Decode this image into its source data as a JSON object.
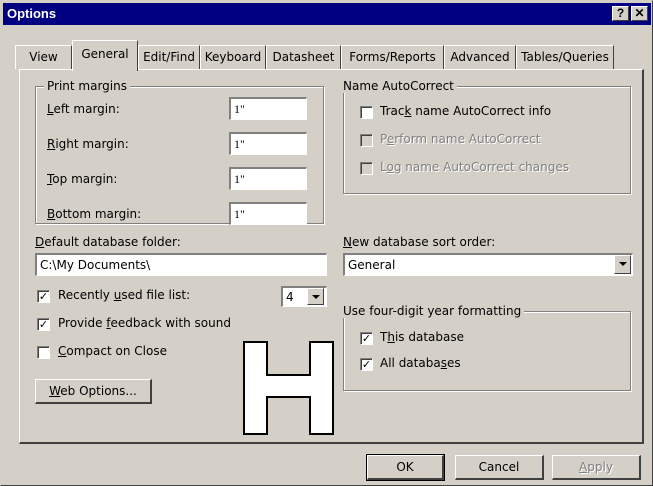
{
  "window": {
    "title": "Options",
    "help_button": "?",
    "close_button": "✕"
  },
  "tabs": [
    {
      "label": "View"
    },
    {
      "label": "General"
    },
    {
      "label": "Edit/Find"
    },
    {
      "label": "Keyboard"
    },
    {
      "label": "Datasheet"
    },
    {
      "label": "Forms/Reports"
    },
    {
      "label": "Advanced"
    },
    {
      "label": "Tables/Queries"
    }
  ],
  "print_margins": {
    "legend": "Print margins",
    "left_label_u": "L",
    "left_label_rest": "eft margin:",
    "left_value": "1\"",
    "right_label_u": "R",
    "right_label_rest": "ight margin:",
    "right_value": "1\"",
    "top_label_u": "T",
    "top_label_rest": "op margin:",
    "top_value": "1\"",
    "bottom_label_u": "B",
    "bottom_label_rest": "ottom margin:",
    "bottom_value": "1\""
  },
  "name_autocorrect": {
    "legend": "Name AutoCorrect",
    "track_pre": "Trac",
    "track_u": "k",
    "track_post": " name AutoCorrect info",
    "perform_pre": "P",
    "perform_u": "e",
    "perform_post": "rform name AutoCorrect",
    "log_pre": "L",
    "log_u": "o",
    "log_post": "g name AutoCorrect changes"
  },
  "default_folder": {
    "label_u": "D",
    "label_rest": "efault database folder:",
    "value": "C:\\My Documents\\"
  },
  "sort_order": {
    "label_u": "N",
    "label_rest": "ew database sort order:",
    "value": "General"
  },
  "recent_files": {
    "label_pre": "Recently ",
    "label_u": "u",
    "label_post": "sed file list:",
    "count": "4"
  },
  "feedback": {
    "label_pre": "Provide ",
    "label_u": "f",
    "label_post": "eedback with sound"
  },
  "compact": {
    "label_u": "C",
    "label_post": "ompact on Close"
  },
  "web_options": {
    "label_u": "W",
    "label_post": "eb Options..."
  },
  "year_format": {
    "legend": "Use four-digit year formatting",
    "this_pre": "T",
    "this_u": "h",
    "this_post": "is database",
    "all_pre": "All databa",
    "all_u": "s",
    "all_post": "es"
  },
  "check_mark": "✓",
  "checked": {
    "track": false,
    "perform": false,
    "log": false,
    "recent": true,
    "feedback": true,
    "compact": false,
    "this_db": true,
    "all_db": true
  },
  "buttons": {
    "ok": "OK",
    "cancel": "Cancel",
    "apply_u": "A",
    "apply_post": "pply"
  }
}
